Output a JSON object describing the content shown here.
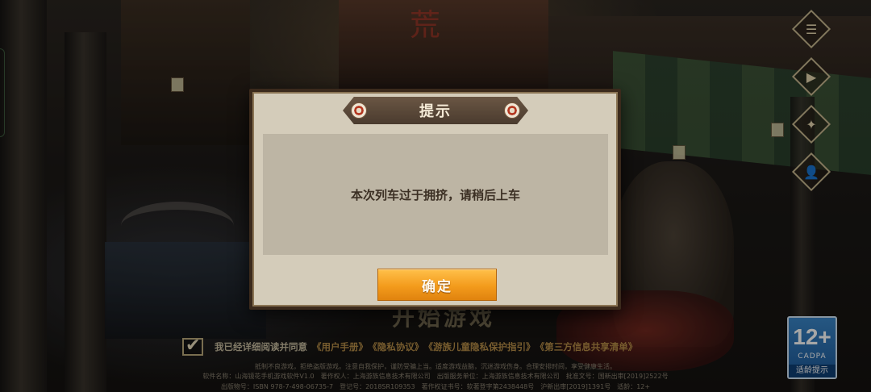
{
  "background": {
    "start_game_label": "开始游戏",
    "banner_text": "荒",
    "edge_indicator": "side-handle"
  },
  "side_menu": [
    {
      "name": "notice-icon",
      "glyph": "☰"
    },
    {
      "name": "video-icon",
      "glyph": "▶"
    },
    {
      "name": "settings-icon",
      "glyph": "✦"
    },
    {
      "name": "user-center-icon",
      "glyph": "👤"
    }
  ],
  "agreement": {
    "prefix": "我已经详细阅读并同意",
    "links": [
      "《用户手册》",
      "《隐私协议》",
      "《游族儿童隐私保护指引》",
      "《第三方信息共享清单》"
    ],
    "checked": true
  },
  "legal": {
    "line1": "抵制不良游戏，拒绝盗版游戏。注意自我保护，谨防受骗上当。适度游戏益脑，沉迷游戏伤身。合理安排时间，享受健康生活。",
    "line2": "软件名称：山海镜花手机游戏软件V1.0　著作权人：上海游族信息技术有限公司　出版服务单位：上海游族信息技术有限公司　批准文号：国新出审[2019]2522号",
    "line3": "出版物号：ISBN 978-7-498-06735-7　登记号：2018SR109353　著作权证书号：软著登字第2438448号　沪新出审[2019]1391号　适龄：12+"
  },
  "age_rating": {
    "number": "12+",
    "org": "CADPA",
    "tip": "适龄提示",
    "color": "#2a70b8"
  },
  "dialog": {
    "title": "提示",
    "message": "本次列车过于拥挤，请稍后上车",
    "confirm_label": "确定",
    "accent_color": "#f39b1c"
  }
}
